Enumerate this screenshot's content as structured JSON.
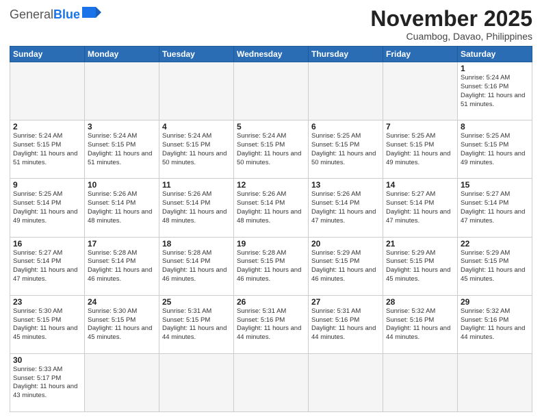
{
  "header": {
    "logo_general": "General",
    "logo_blue": "Blue",
    "month_title": "November 2025",
    "location": "Cuambog, Davao, Philippines"
  },
  "days_of_week": [
    "Sunday",
    "Monday",
    "Tuesday",
    "Wednesday",
    "Thursday",
    "Friday",
    "Saturday"
  ],
  "weeks": [
    [
      {
        "day": "",
        "empty": true
      },
      {
        "day": "",
        "empty": true
      },
      {
        "day": "",
        "empty": true
      },
      {
        "day": "",
        "empty": true
      },
      {
        "day": "",
        "empty": true
      },
      {
        "day": "",
        "empty": true
      },
      {
        "day": "1",
        "sunrise": "Sunrise: 5:24 AM",
        "sunset": "Sunset: 5:16 PM",
        "daylight": "Daylight: 11 hours and 51 minutes."
      }
    ],
    [
      {
        "day": "2",
        "sunrise": "Sunrise: 5:24 AM",
        "sunset": "Sunset: 5:15 PM",
        "daylight": "Daylight: 11 hours and 51 minutes."
      },
      {
        "day": "3",
        "sunrise": "Sunrise: 5:24 AM",
        "sunset": "Sunset: 5:15 PM",
        "daylight": "Daylight: 11 hours and 51 minutes."
      },
      {
        "day": "4",
        "sunrise": "Sunrise: 5:24 AM",
        "sunset": "Sunset: 5:15 PM",
        "daylight": "Daylight: 11 hours and 50 minutes."
      },
      {
        "day": "5",
        "sunrise": "Sunrise: 5:24 AM",
        "sunset": "Sunset: 5:15 PM",
        "daylight": "Daylight: 11 hours and 50 minutes."
      },
      {
        "day": "6",
        "sunrise": "Sunrise: 5:25 AM",
        "sunset": "Sunset: 5:15 PM",
        "daylight": "Daylight: 11 hours and 50 minutes."
      },
      {
        "day": "7",
        "sunrise": "Sunrise: 5:25 AM",
        "sunset": "Sunset: 5:15 PM",
        "daylight": "Daylight: 11 hours and 49 minutes."
      },
      {
        "day": "8",
        "sunrise": "Sunrise: 5:25 AM",
        "sunset": "Sunset: 5:15 PM",
        "daylight": "Daylight: 11 hours and 49 minutes."
      }
    ],
    [
      {
        "day": "9",
        "sunrise": "Sunrise: 5:25 AM",
        "sunset": "Sunset: 5:14 PM",
        "daylight": "Daylight: 11 hours and 49 minutes."
      },
      {
        "day": "10",
        "sunrise": "Sunrise: 5:26 AM",
        "sunset": "Sunset: 5:14 PM",
        "daylight": "Daylight: 11 hours and 48 minutes."
      },
      {
        "day": "11",
        "sunrise": "Sunrise: 5:26 AM",
        "sunset": "Sunset: 5:14 PM",
        "daylight": "Daylight: 11 hours and 48 minutes."
      },
      {
        "day": "12",
        "sunrise": "Sunrise: 5:26 AM",
        "sunset": "Sunset: 5:14 PM",
        "daylight": "Daylight: 11 hours and 48 minutes."
      },
      {
        "day": "13",
        "sunrise": "Sunrise: 5:26 AM",
        "sunset": "Sunset: 5:14 PM",
        "daylight": "Daylight: 11 hours and 47 minutes."
      },
      {
        "day": "14",
        "sunrise": "Sunrise: 5:27 AM",
        "sunset": "Sunset: 5:14 PM",
        "daylight": "Daylight: 11 hours and 47 minutes."
      },
      {
        "day": "15",
        "sunrise": "Sunrise: 5:27 AM",
        "sunset": "Sunset: 5:14 PM",
        "daylight": "Daylight: 11 hours and 47 minutes."
      }
    ],
    [
      {
        "day": "16",
        "sunrise": "Sunrise: 5:27 AM",
        "sunset": "Sunset: 5:14 PM",
        "daylight": "Daylight: 11 hours and 47 minutes."
      },
      {
        "day": "17",
        "sunrise": "Sunrise: 5:28 AM",
        "sunset": "Sunset: 5:14 PM",
        "daylight": "Daylight: 11 hours and 46 minutes."
      },
      {
        "day": "18",
        "sunrise": "Sunrise: 5:28 AM",
        "sunset": "Sunset: 5:14 PM",
        "daylight": "Daylight: 11 hours and 46 minutes."
      },
      {
        "day": "19",
        "sunrise": "Sunrise: 5:28 AM",
        "sunset": "Sunset: 5:15 PM",
        "daylight": "Daylight: 11 hours and 46 minutes."
      },
      {
        "day": "20",
        "sunrise": "Sunrise: 5:29 AM",
        "sunset": "Sunset: 5:15 PM",
        "daylight": "Daylight: 11 hours and 46 minutes."
      },
      {
        "day": "21",
        "sunrise": "Sunrise: 5:29 AM",
        "sunset": "Sunset: 5:15 PM",
        "daylight": "Daylight: 11 hours and 45 minutes."
      },
      {
        "day": "22",
        "sunrise": "Sunrise: 5:29 AM",
        "sunset": "Sunset: 5:15 PM",
        "daylight": "Daylight: 11 hours and 45 minutes."
      }
    ],
    [
      {
        "day": "23",
        "sunrise": "Sunrise: 5:30 AM",
        "sunset": "Sunset: 5:15 PM",
        "daylight": "Daylight: 11 hours and 45 minutes."
      },
      {
        "day": "24",
        "sunrise": "Sunrise: 5:30 AM",
        "sunset": "Sunset: 5:15 PM",
        "daylight": "Daylight: 11 hours and 45 minutes."
      },
      {
        "day": "25",
        "sunrise": "Sunrise: 5:31 AM",
        "sunset": "Sunset: 5:15 PM",
        "daylight": "Daylight: 11 hours and 44 minutes."
      },
      {
        "day": "26",
        "sunrise": "Sunrise: 5:31 AM",
        "sunset": "Sunset: 5:16 PM",
        "daylight": "Daylight: 11 hours and 44 minutes."
      },
      {
        "day": "27",
        "sunrise": "Sunrise: 5:31 AM",
        "sunset": "Sunset: 5:16 PM",
        "daylight": "Daylight: 11 hours and 44 minutes."
      },
      {
        "day": "28",
        "sunrise": "Sunrise: 5:32 AM",
        "sunset": "Sunset: 5:16 PM",
        "daylight": "Daylight: 11 hours and 44 minutes."
      },
      {
        "day": "29",
        "sunrise": "Sunrise: 5:32 AM",
        "sunset": "Sunset: 5:16 PM",
        "daylight": "Daylight: 11 hours and 44 minutes."
      }
    ],
    [
      {
        "day": "30",
        "sunrise": "Sunrise: 5:33 AM",
        "sunset": "Sunset: 5:17 PM",
        "daylight": "Daylight: 11 hours and 43 minutes."
      },
      {
        "day": "",
        "empty": true
      },
      {
        "day": "",
        "empty": true
      },
      {
        "day": "",
        "empty": true
      },
      {
        "day": "",
        "empty": true
      },
      {
        "day": "",
        "empty": true
      },
      {
        "day": "",
        "empty": true
      }
    ]
  ]
}
